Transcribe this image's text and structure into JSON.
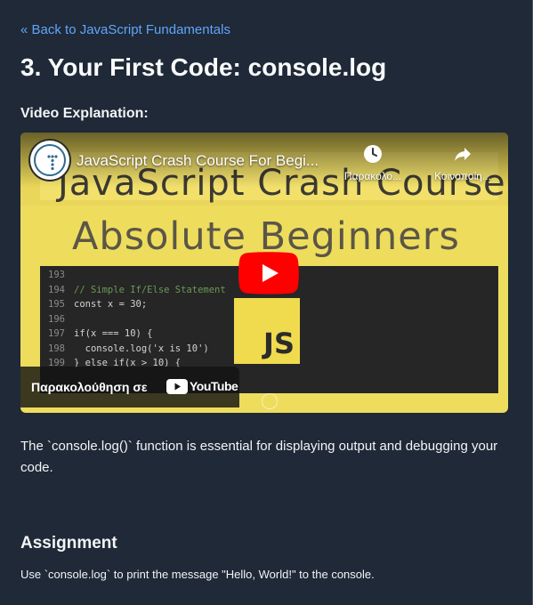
{
  "nav": {
    "back_label": "« Back to JavaScript Fundamentals"
  },
  "lesson": {
    "title": "3. Your First Code: console.log",
    "video_label": "Video Explanation:",
    "description": "The `console.log()` function is essential for displaying output and debugging your code."
  },
  "video": {
    "title": "JavaScript Crash Course For Begi...",
    "watch_later_label": "Παρακολο...",
    "share_label": "Κοινοποίη...",
    "thumbnail_heading": "JavaScript Crash Course",
    "thumbnail_subheading": "Absolute Beginners",
    "watch_on_label": "Παρακολούθηση σε",
    "youtube_label": "YouTube",
    "js_badge": "JS",
    "code_lines": [
      {
        "num": "193",
        "code": ""
      },
      {
        "num": "194",
        "code": "// Simple If/Else Statement"
      },
      {
        "num": "195",
        "code": "const x = 30;"
      },
      {
        "num": "196",
        "code": ""
      },
      {
        "num": "197",
        "code": "if(x === 10) {"
      },
      {
        "num": "198",
        "code": "  console.log('x is 10')"
      },
      {
        "num": "199",
        "code": "} else if(x > 10) {"
      }
    ],
    "colors": {
      "play": "#ff0000",
      "thumbnail": "#eedd5c"
    }
  },
  "assignment": {
    "heading": "Assignment",
    "text": "Use `console.log` to print the message \"Hello, World!\" to the console."
  },
  "theme": {
    "background": "#1f2937",
    "link": "#60a5fa"
  }
}
